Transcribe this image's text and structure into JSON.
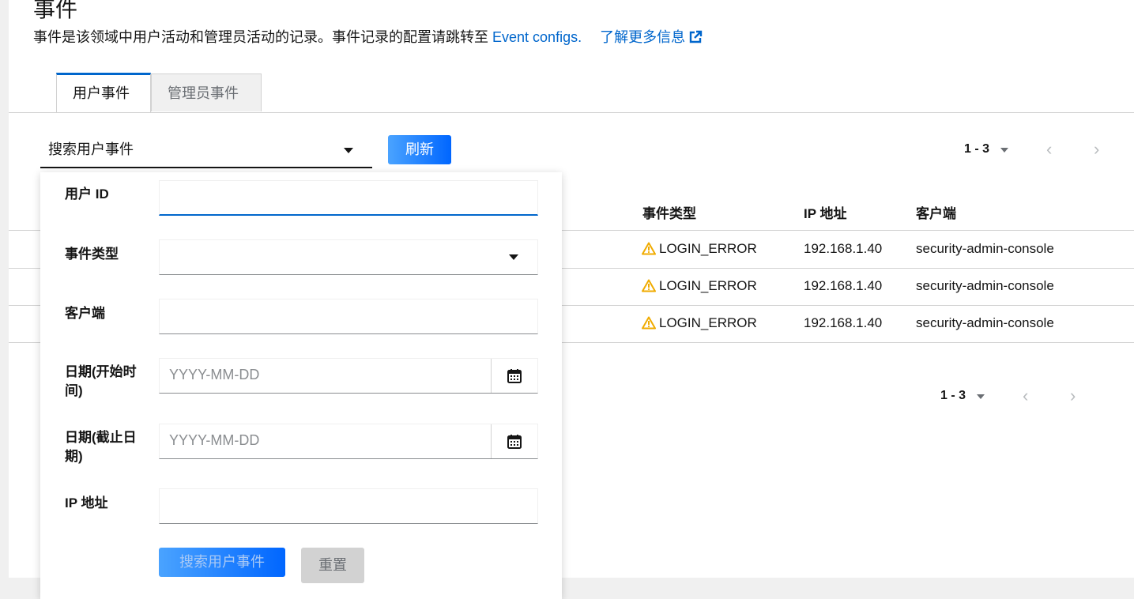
{
  "page": {
    "title": "事件",
    "description": "事件是该领域中用户活动和管理员活动的记录。事件记录的配置请跳转至",
    "event_configs_link": "Event configs.",
    "learn_more_link": "了解更多信息"
  },
  "tabs": [
    {
      "label": "用户事件",
      "active": true
    },
    {
      "label": "管理员事件",
      "active": false
    }
  ],
  "toolbar": {
    "search_toggle_label": "搜索用户事件",
    "refresh_label": "刷新",
    "pagination": "1 - 3"
  },
  "table": {
    "columns": [
      "事件类型",
      "IP 地址",
      "客户端"
    ],
    "rows": [
      {
        "event_type": "LOGIN_ERROR",
        "ip": "192.168.1.40",
        "client": "security-admin-console"
      },
      {
        "event_type": "LOGIN_ERROR",
        "ip": "192.168.1.40",
        "client": "security-admin-console"
      },
      {
        "event_type": "LOGIN_ERROR",
        "ip": "192.168.1.40",
        "client": "security-admin-console"
      }
    ]
  },
  "bottom_pagination": "1 - 3",
  "search_form": {
    "user_id_label": "用户 ID",
    "event_type_label": "事件类型",
    "client_label": "客户端",
    "date_from_label": "日期(开始时间)",
    "date_to_label": "日期(截止日期)",
    "ip_label": "IP 地址",
    "date_placeholder": "YYYY-MM-DD",
    "search_button": "搜索用户事件",
    "reset_button": "重置"
  },
  "colors": {
    "accent": "#0066cc",
    "warning": "#f0ab00"
  }
}
